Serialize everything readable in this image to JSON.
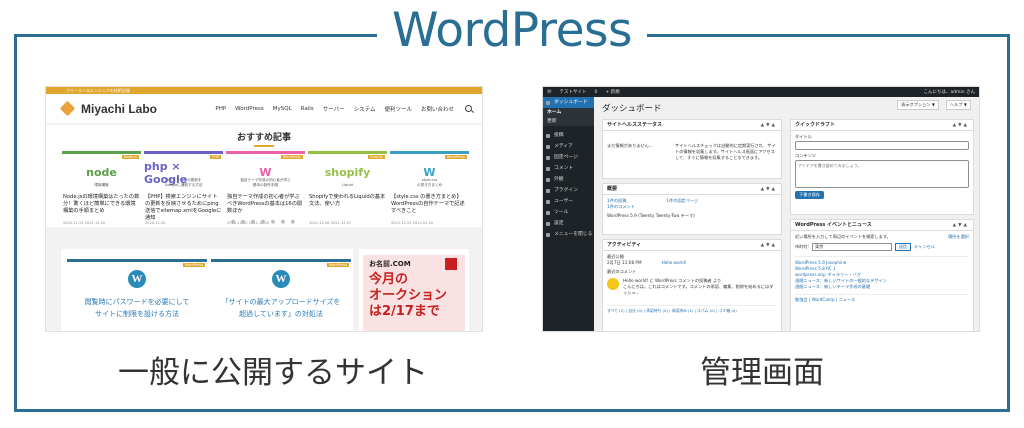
{
  "title": "WordPress",
  "captions": {
    "left": "一般に公開するサイト",
    "right": "管理画面"
  },
  "site": {
    "topbar": "フリーランスエンジニアの技術記録",
    "logo": "Miyachi Labo",
    "nav": [
      "PHP",
      "WordPress",
      "MySQL",
      "Rails",
      "サーバー",
      "システム",
      "便利ツール",
      "お問い合わせ"
    ],
    "rec_title": "おすすめ記事",
    "cards": [
      {
        "mark": "node",
        "sub": "環境構築",
        "tag": "Node.js",
        "text": "Node.jsの環境構築はたったの数分！驚くほど簡単にできる環境構築の手順まとめ",
        "date": "2020.11.24 2021.12.20",
        "color": "#5aa04a"
      },
      {
        "mark": "php × Google",
        "sub": "サイトマップの更新を\nGoogleに通知する方法",
        "tag": "PHP",
        "text": "【PHP】検索エンジンにサイトの更新を反映させるためにping送信でsitemap.xmlをGoogleに通知",
        "date": "2020.11.30",
        "color": "#6a62c8"
      },
      {
        "mark": "W",
        "sub": "独自テーマ作成の初心者が学ぶ\n基本の制作手順",
        "tag": "WordPress",
        "text": "独自テーマ作成の初心者が学ぶべきWordPressの基本は16の関数ほか",
        "date": "2020.12.15 2021.12.20",
        "color": "#e85fa5"
      },
      {
        "mark": "shopify",
        "sub": "Liquid",
        "tag": "Shopify",
        "text": "Shopifyで使われるLiquidの基本文法、使い方",
        "date": "2021.12.06 2021.12.07",
        "color": "#96bf48"
      },
      {
        "mark": "W",
        "sub": "style.css\nの書き方まとめ",
        "tag": "WordPress",
        "text": "【style.css の書き方まとめ】WordPressの自作テーマで記述すべきこと",
        "date": "2021.12.23 2022.01.20",
        "color": "#3aa0c8"
      }
    ],
    "lower": [
      {
        "text": "閲覧時にパスワードを必要にして\nサイトに制限を設ける方法",
        "badge": "WordPress"
      },
      {
        "text": "「サイトの最大アップロードサイズを\n超過しています」の対処法",
        "badge": "WordPress"
      }
    ],
    "ad": {
      "brand": "お名前.COM",
      "copy": "今月の\nオークション\nは2/17まで"
    }
  },
  "admin": {
    "bar": [
      "テストサイト",
      "0",
      "+ 新規"
    ],
    "bar_right": "こんにちは、admin さん",
    "sidebar": [
      {
        "label": "ダッシュボード",
        "type": "active"
      },
      {
        "label": "ホーム",
        "type": "sub-bold"
      },
      {
        "label": "更新",
        "type": "sub"
      },
      {
        "label": "投稿",
        "type": "item"
      },
      {
        "label": "メディア",
        "type": "item"
      },
      {
        "label": "固定ページ",
        "type": "item"
      },
      {
        "label": "コメント",
        "type": "item"
      },
      {
        "label": "外観",
        "type": "item"
      },
      {
        "label": "プラグイン",
        "type": "item"
      },
      {
        "label": "ユーザー",
        "type": "item"
      },
      {
        "label": "ツール",
        "type": "item"
      },
      {
        "label": "設定",
        "type": "item"
      },
      {
        "label": "メニューを閉じる",
        "type": "item"
      }
    ],
    "page_title": "ダッシュボード",
    "btn_options": "表示オプション ▼",
    "btn_help": "ヘルプ ▼",
    "health": {
      "title": "サイトヘルスステータス",
      "left": "まだ情報がありません…",
      "right": "サイトヘルスチェックは自動的に定期実行され、サイトの情報を収集します。サイトヘルス画面にアクセスして、すぐに情報を収集することもできます。"
    },
    "glance": {
      "title": "概要",
      "items": [
        "1件の投稿",
        "1件の固定ページ",
        "1件のコメント"
      ],
      "theme": "WordPress 5.9 (Twenty Twenty-Two テーマ)"
    },
    "activity": {
      "title": "アクティビティ",
      "recent": "最近公開",
      "date": "2月7日 11:08 PM",
      "post": "Hello world!",
      "comments": "最近のコメント",
      "comment": "Hello world! に WordPress コメントの投稿者 より\nこんにちは。これはコメントです。コメントの承認、編集、削除を始めるにはダッシュ...",
      "filters": "すべて (1) | 自分 (0) | 承認待ち (0) | 承認済み (1) | スパム (0) | ゴミ箱 (0)"
    },
    "draft": {
      "title": "クイックドラフト",
      "label_title": "タイトル",
      "label_content": "コンテンツ",
      "placeholder": "アイデアを書き留めてみましょう。",
      "button": "下書き保存"
    },
    "events": {
      "title": "WordPress イベントとニュース",
      "intro": "近い場所を入力して周辺のイベントを検索します。",
      "select": "場所を選択",
      "city_label": "市町村:",
      "city": "東京",
      "submit": "送信",
      "cancel": "キャンセル",
      "news": [
        "WordPress 5.9 Josephine",
        "WordPress 5.8 RC 1",
        "wordpress.org: ギャラリー・バグ",
        "週間ニュース：新しいサイトの一般的なデザイン",
        "週間ニュース：新しいテーマ作成の基礎"
      ],
      "footer": "勉強会 | WordCamp | ニュース"
    }
  }
}
